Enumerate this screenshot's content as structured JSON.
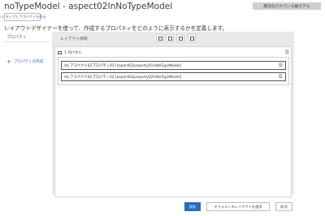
{
  "page": {
    "title": "noTypeModel - aspect02InNoTypeModel",
    "badge": "無効化されている戦モデル",
    "types_button": "<< タイプとアスペクトを表示",
    "description": "レイアウトデザイナーを使って、作成するプロパティをどのように表示するかを定義します。"
  },
  "properties_panel": {
    "header": "プロパティ",
    "add_property": "プロパティの作成"
  },
  "layout_area": {
    "header": "レイアウト領域",
    "tools": [
      "single-column-icon",
      "two-column-icon",
      "three-column-icon",
      "four-column-icon"
    ],
    "panel_title": "1 列パネル",
    "rows": [
      {
        "label": "Aa アスペクト02プロパティ01 [aspect02property01InNoTypeModel]"
      },
      {
        "label": "Aa アスペクト02プロパティ02 [aspect02property02InNoTypeModel]"
      }
    ]
  },
  "footer": {
    "save": "保存",
    "default_layout": "デフォルトのレイアウトを適用",
    "cancel": "取消"
  },
  "colors": {
    "primary": "#2a6ebd",
    "link": "#3b6db4",
    "area_bg": "#e9e9e9"
  }
}
